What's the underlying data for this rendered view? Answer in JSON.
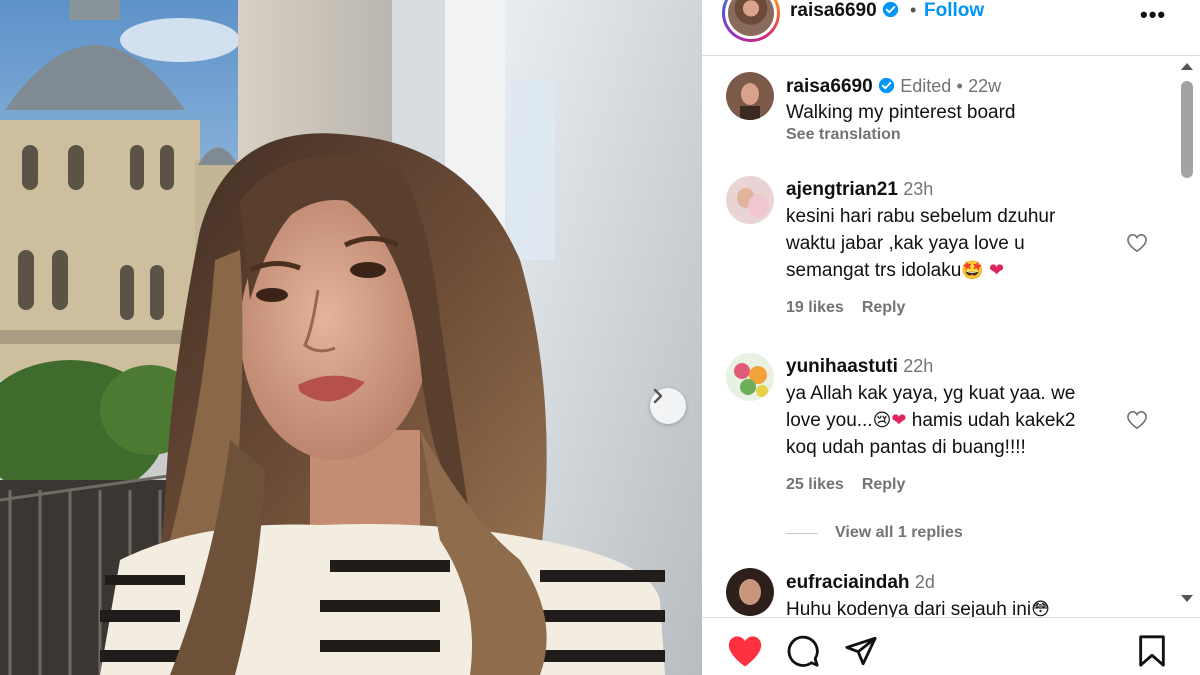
{
  "header": {
    "username": "raisa6690",
    "separator": "•",
    "follow_label": "Follow",
    "more_label": "•••"
  },
  "caption": {
    "username": "raisa6690",
    "edited": "Edited",
    "separator": "•",
    "age": "22w",
    "text": "Walking my pinterest board",
    "see_translation": "See translation"
  },
  "comments": [
    {
      "username": "ajengtrian21",
      "age": "23h",
      "lines": [
        "kesini hari rabu sebelum dzuhur",
        "waktu jabar ,kak yaya love u",
        "semangat trs idolaku"
      ],
      "likes": "19 likes",
      "reply": "Reply"
    },
    {
      "username": "yunihaastuti",
      "age": "22h",
      "lines": [
        "ya Allah kak yaya, yg kuat yaa. we",
        "love you...",
        "hamis udah kakek2",
        "koq udah pantas di buang!!!!"
      ],
      "likes": "25 likes",
      "reply": "Reply",
      "view_replies": "View all 1 replies"
    },
    {
      "username": "eufraciaindah",
      "age": "2d",
      "lines": [
        "Huhu kodenya dari sejauh ini"
      ]
    }
  ],
  "emoji": {
    "star_eyes": "🤩",
    "heart": "❤",
    "sad": "😢",
    "blush": "😳"
  },
  "icons": {
    "verified": "verified-badge-icon",
    "like": "heart-icon",
    "comment": "comment-icon",
    "share": "send-icon",
    "save": "bookmark-icon",
    "next": "chevron-right-icon",
    "more": "more-options-icon"
  },
  "colors": {
    "accent": "#0095f6",
    "like_active": "#ff3040",
    "muted_text": "#737373",
    "divider": "#dbdbdb"
  }
}
